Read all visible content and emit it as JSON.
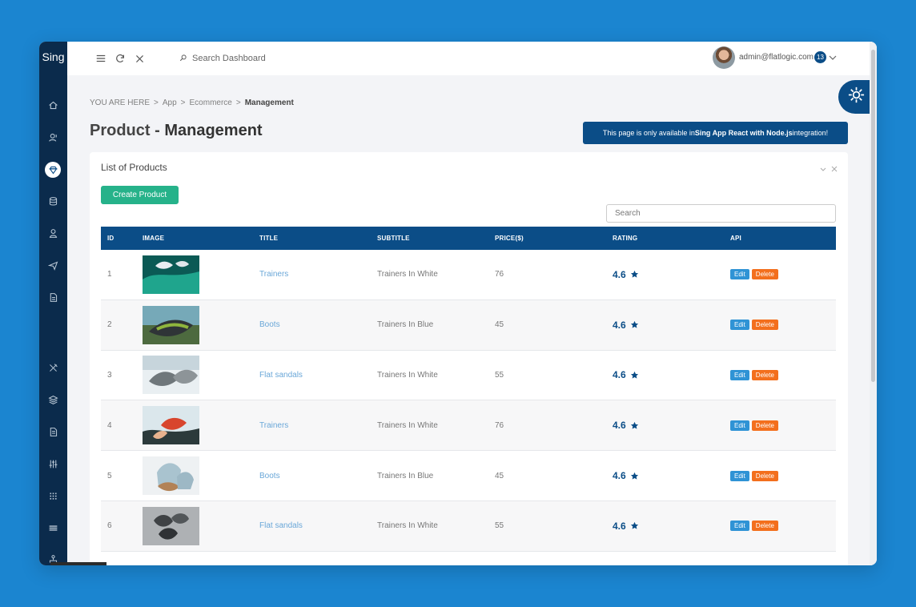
{
  "sidebar": {
    "brand": "Sing",
    "icons": [
      "home-icon",
      "user-voice-icon",
      "diamond-icon",
      "database-icon",
      "person-icon",
      "send-icon",
      "document-icon",
      "tools-icon",
      "layers-icon",
      "file-icon",
      "sliders-icon",
      "grid-icon",
      "stack-icon",
      "network-icon"
    ]
  },
  "topbar": {
    "search_placeholder": "Search Dashboard",
    "user_email": "admin@flatlogic.com",
    "notification_count": "13"
  },
  "breadcrumb": {
    "prefix": "YOU ARE HERE",
    "items": [
      "App",
      "Ecommerce",
      "Management"
    ]
  },
  "page_title": {
    "light": "Product - ",
    "bold": "Management"
  },
  "banner": {
    "prefix": "This page is only available in ",
    "bold": "Sing App React with Node.js",
    "suffix": " integration!"
  },
  "panel": {
    "title": "List of Products",
    "create_label": "Create Product",
    "search_placeholder": "Search"
  },
  "table": {
    "headers": [
      "ID",
      "IMAGE",
      "TITLE",
      "SUBTITLE",
      "PRICE($)",
      "RATING",
      "API"
    ],
    "rows": [
      {
        "id": "1",
        "image": "trainers-photo",
        "title": "Trainers",
        "subtitle": "Trainers In White",
        "price": "76",
        "rating": "4.6",
        "edit_label": "Edit",
        "delete_label": "Delete"
      },
      {
        "id": "2",
        "image": "boots-photo",
        "title": "Boots",
        "subtitle": "Trainers In Blue",
        "price": "45",
        "rating": "4.6",
        "edit_label": "Edit",
        "delete_label": "Delete"
      },
      {
        "id": "3",
        "image": "flat-sandals-photo",
        "title": "Flat sandals",
        "subtitle": "Trainers In White",
        "price": "55",
        "rating": "4.6",
        "edit_label": "Edit",
        "delete_label": "Delete"
      },
      {
        "id": "4",
        "image": "red-trainers-photo",
        "title": "Trainers",
        "subtitle": "Trainers In White",
        "price": "76",
        "rating": "4.6",
        "edit_label": "Edit",
        "delete_label": "Delete"
      },
      {
        "id": "5",
        "image": "tan-boots-photo",
        "title": "Boots",
        "subtitle": "Trainers In Blue",
        "price": "45",
        "rating": "4.6",
        "edit_label": "Edit",
        "delete_label": "Delete"
      },
      {
        "id": "6",
        "image": "grey-sandals-photo",
        "title": "Flat sandals",
        "subtitle": "Trainers In White",
        "price": "55",
        "rating": "4.6",
        "edit_label": "Edit",
        "delete_label": "Delete"
      }
    ]
  },
  "colors": {
    "background": "#1b85d0",
    "sidebar": "#0b2b4c",
    "primary": "#0b4d87",
    "success": "#26b28a",
    "edit": "#2f93d5",
    "delete": "#f36f1d"
  }
}
